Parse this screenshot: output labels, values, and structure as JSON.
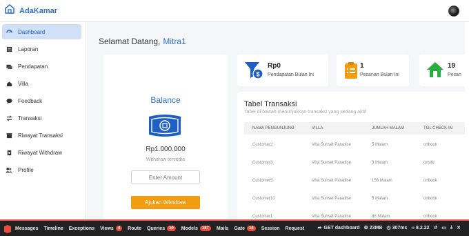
{
  "app": {
    "name": "AdaKamar"
  },
  "sidebar": {
    "items": [
      {
        "label": "Dashboard",
        "icon": "dashboard-icon"
      },
      {
        "label": "Laporan",
        "icon": "report-icon"
      },
      {
        "label": "Pendapatan",
        "icon": "income-icon"
      },
      {
        "label": "Villa",
        "icon": "house-icon"
      },
      {
        "label": "Feedback",
        "icon": "comment-icon"
      },
      {
        "label": "Transaksi",
        "icon": "transaction-icon"
      },
      {
        "label": "Riwayat Transaksi",
        "icon": "history-icon"
      },
      {
        "label": "Riwayat Withdraw",
        "icon": "withdraw-icon"
      },
      {
        "label": "Profile",
        "icon": "users-icon"
      }
    ]
  },
  "greeting": {
    "text": "Selamat Datang,",
    "name": "Mitra1"
  },
  "balance": {
    "title": "Balance",
    "amount": "Rp1.000.000",
    "subtitle": "Withdraw tersedia",
    "input_placeholder": "Enter Amount",
    "button_label": "Ajukan Withdraw"
  },
  "stats": [
    {
      "value": "Rp0",
      "label": "Pendapatan Bulan Ini",
      "icon": "filter-dollar-icon",
      "color": "#2f6fd6"
    },
    {
      "value": "1",
      "label": "Pesanan Bulan Ini",
      "icon": "clipboard-icon",
      "color": "#f39c12"
    },
    {
      "value": "19",
      "label": "Pesan",
      "icon": "house-icon",
      "color": "#27ae3c"
    }
  ],
  "table": {
    "title": "Tabel Transaksi",
    "subtitle": "Tabel di bawah menunjukkan transaksi yang sedang aktif",
    "columns": [
      "NAMA PENGUNJUNG",
      "VILLA",
      "JUMLAH MALAM",
      "TGL CHECK-IN"
    ],
    "rows": [
      [
        "Customer2",
        "Villa Sunset Paradise",
        "5 Malam",
        "onbook"
      ],
      [
        "Customer3",
        "Villa Sunset Paradise",
        "3 Malam",
        "onsite"
      ],
      [
        "Customer5",
        "Villa Sunset Paradise",
        "156 Malam",
        "onbook"
      ],
      [
        "Customer10",
        "Villa Sunset Paradise",
        "5 Malam",
        "onbook"
      ],
      [
        "Customer1",
        "Villa Sunset Paradise",
        "88 Malam",
        "onbook"
      ]
    ]
  },
  "debugbar": {
    "items": [
      {
        "label": "Messages"
      },
      {
        "label": "Timeline"
      },
      {
        "label": "Exceptions"
      },
      {
        "label": "Views",
        "badge": "4"
      },
      {
        "label": "Route"
      },
      {
        "label": "Queries",
        "badge": "10"
      },
      {
        "label": "Models",
        "badge": "187"
      },
      {
        "label": "Mails"
      },
      {
        "label": "Gate",
        "badge": "14"
      },
      {
        "label": "Session"
      },
      {
        "label": "Request"
      }
    ],
    "request": "GET dashboard",
    "memory": "23MB",
    "time": "307ms",
    "php_version": "8.2.22"
  }
}
